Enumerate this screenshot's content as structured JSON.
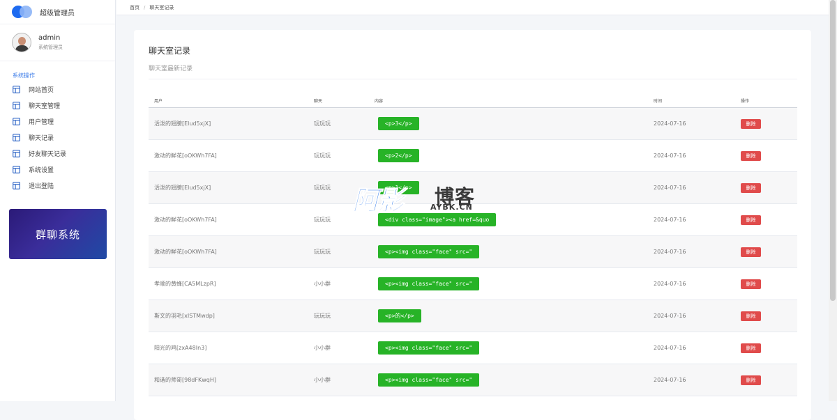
{
  "brand": {
    "name": "超级管理员"
  },
  "user": {
    "name": "admin",
    "role": "系统管理员"
  },
  "sidebar": {
    "section": "系统操作",
    "items": [
      {
        "label": "网站首页"
      },
      {
        "label": "聊天室管理"
      },
      {
        "label": "用户管理"
      },
      {
        "label": "聊天记录"
      },
      {
        "label": "好友聊天记录"
      },
      {
        "label": "系统设置"
      },
      {
        "label": "退出登陆"
      }
    ],
    "promo": "群聊系统"
  },
  "breadcrumb": {
    "home": "首页",
    "sep": "/",
    "current": "聊天室记录"
  },
  "card": {
    "title": "聊天室记录",
    "subtitle": "聊天室最新记录"
  },
  "table": {
    "headers": {
      "user": "用户",
      "room": "聊天",
      "content": "内容",
      "time": "时间",
      "op": "操作"
    },
    "rows": [
      {
        "user": "活泼的翅膀[Elud5xjX]",
        "room": "玩玩玩",
        "content": "<p>3</p>",
        "time": "2024-07-16",
        "op": "删除"
      },
      {
        "user": "激动的鲜花[oOKWh7FA]",
        "room": "玩玩玩",
        "content": "<p>2</p>",
        "time": "2024-07-16",
        "op": "删除"
      },
      {
        "user": "活泼的翅膀[Elud5xjX]",
        "room": "玩玩玩",
        "content": "<p>1</p>",
        "time": "2024-07-16",
        "op": "删除"
      },
      {
        "user": "激动的鲜花[oOKWh7FA]",
        "room": "玩玩玩",
        "content": "<div class=\"image\"><a href=&quo",
        "time": "2024-07-16",
        "op": "删除"
      },
      {
        "user": "激动的鲜花[oOKWh7FA]",
        "room": "玩玩玩",
        "content": "<p><img class=\"face\" src=\"",
        "time": "2024-07-16",
        "op": "删除"
      },
      {
        "user": "孝顺的黄蜂[CA5MLzpR]",
        "room": "小小群",
        "content": "<p><img class=\"face\" src=\"",
        "time": "2024-07-16",
        "op": "删除"
      },
      {
        "user": "斯文的羽毛[xISTMwdp]",
        "room": "玩玩玩",
        "content": "<p>的</p>",
        "time": "2024-07-16",
        "op": "删除"
      },
      {
        "user": "阳光的鸡[zxA48In3]",
        "room": "小小群",
        "content": "<p><img class=\"face\" src=\"",
        "time": "2024-07-16",
        "op": "删除"
      },
      {
        "user": "和谐的师哥[98dFKwqH]",
        "room": "小小群",
        "content": "<p><img class=\"face\" src=\"",
        "time": "2024-07-16",
        "op": "删除"
      }
    ]
  },
  "watermark": {
    "main": "阿影",
    "sub": "博客",
    "url": "AYBK.CN"
  },
  "colors": {
    "accent": "#1e6bf0",
    "success": "#27b327",
    "danger": "#e04b4b"
  },
  "icons": {
    "nav": "layout-icon"
  }
}
